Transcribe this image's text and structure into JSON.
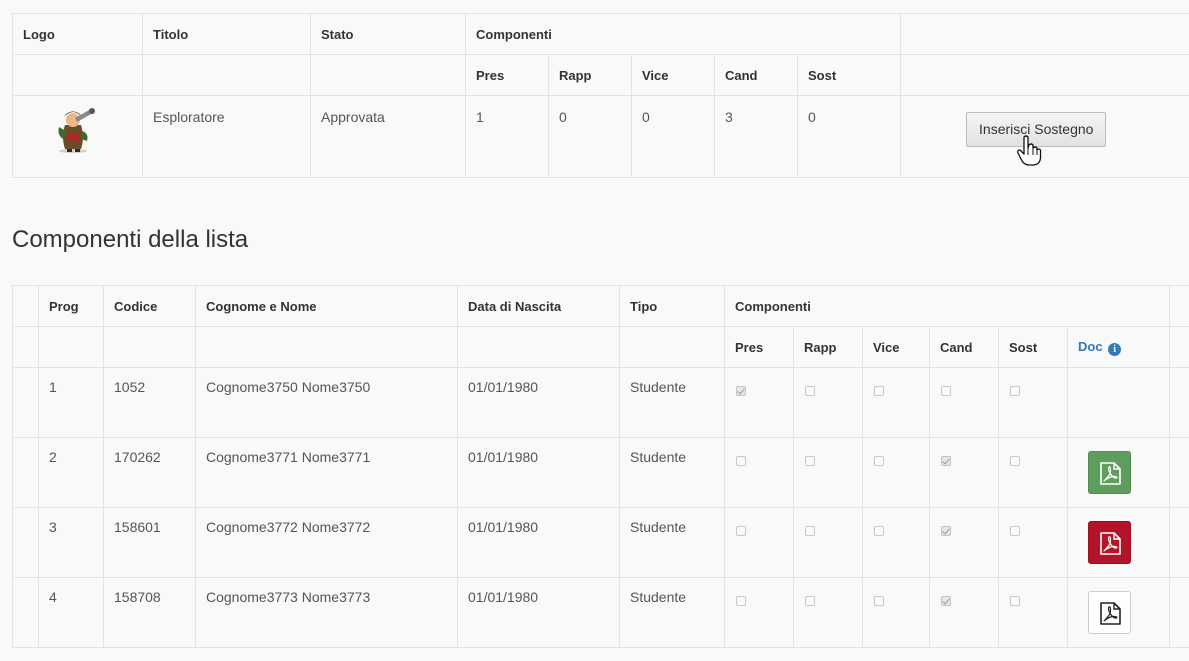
{
  "list_table": {
    "headers": {
      "logo": "Logo",
      "titolo": "Titolo",
      "stato": "Stato",
      "componenti": "Componenti",
      "pres": "Pres",
      "rapp": "Rapp",
      "vice": "Vice",
      "cand": "Cand",
      "sost": "Sost"
    },
    "row": {
      "logo_icon": "explorer-mascot-logo",
      "titolo": "Esploratore",
      "stato": "Approvata",
      "pres": "1",
      "rapp": "0",
      "vice": "0",
      "cand": "3",
      "sost": "0",
      "button_label": "Inserisci Sostegno"
    }
  },
  "section_title": "Componenti della lista",
  "components_table": {
    "headers": {
      "prog": "Prog",
      "codice": "Codice",
      "nome": "Cognome e Nome",
      "data": "Data di Nascita",
      "tipo": "Tipo",
      "componenti": "Componenti",
      "pres": "Pres",
      "rapp": "Rapp",
      "vice": "Vice",
      "cand": "Cand",
      "sost": "Sost",
      "doc": "Doc"
    },
    "rows": [
      {
        "prog": "1",
        "codice": "1052",
        "nome": "Cognome3750 Nome3750",
        "data": "01/01/1980",
        "tipo": "Studente",
        "pres": true,
        "rapp": false,
        "vice": false,
        "cand": false,
        "sost": false,
        "doc": "none"
      },
      {
        "prog": "2",
        "codice": "170262",
        "nome": "Cognome3771 Nome3771",
        "data": "01/01/1980",
        "tipo": "Studente",
        "pres": false,
        "rapp": false,
        "vice": false,
        "cand": true,
        "sost": false,
        "doc": "green"
      },
      {
        "prog": "3",
        "codice": "158601",
        "nome": "Cognome3772 Nome3772",
        "data": "01/01/1980",
        "tipo": "Studente",
        "pres": false,
        "rapp": false,
        "vice": false,
        "cand": true,
        "sost": false,
        "doc": "red"
      },
      {
        "prog": "4",
        "codice": "158708",
        "nome": "Cognome3773 Nome3773",
        "data": "01/01/1980",
        "tipo": "Studente",
        "pres": false,
        "rapp": false,
        "vice": false,
        "cand": true,
        "sost": false,
        "doc": "white"
      }
    ]
  },
  "colors": {
    "link_blue": "#337ab7",
    "doc_green": "#5f9d5f",
    "doc_red": "#b3142a"
  }
}
